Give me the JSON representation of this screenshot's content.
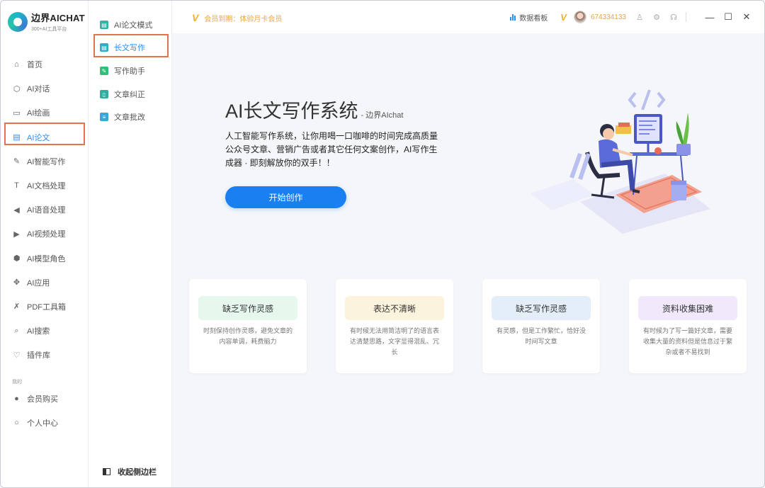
{
  "app": {
    "logo_title": "边界AICHAT",
    "logo_subtitle": "300+AI工具平台"
  },
  "sidebar": {
    "items": [
      {
        "label": "首页",
        "icon": "home-icon"
      },
      {
        "label": "AI对话",
        "icon": "cube-icon"
      },
      {
        "label": "AI绘画",
        "icon": "image-icon"
      },
      {
        "label": "AI论文",
        "icon": "document-icon",
        "active": true
      },
      {
        "label": "AI智能写作",
        "icon": "pen-icon"
      },
      {
        "label": "AI文档处理",
        "icon": "text-icon"
      },
      {
        "label": "AI语音处理",
        "icon": "speaker-icon"
      },
      {
        "label": "AI视频处理",
        "icon": "play-icon"
      },
      {
        "label": "AI模型角色",
        "icon": "cubes-icon"
      },
      {
        "label": "AI应用",
        "icon": "apps-icon"
      },
      {
        "label": "PDF工具箱",
        "icon": "wrench-icon"
      },
      {
        "label": "AI搜索",
        "icon": "search-icon"
      },
      {
        "label": "插件库",
        "icon": "bulb-icon"
      }
    ],
    "section_label": "我的",
    "my_items": [
      {
        "label": "会员购买",
        "icon": "user-icon"
      },
      {
        "label": "个人中心",
        "icon": "user-outline-icon"
      }
    ]
  },
  "subbar": {
    "items": [
      {
        "label": "AI论文模式",
        "color": "#2fb6a8"
      },
      {
        "label": "长文写作",
        "color": "#26b3c4",
        "active": true
      },
      {
        "label": "写作助手",
        "color": "#2fbf7a"
      },
      {
        "label": "文章纠正",
        "color": "#2bb0a0"
      },
      {
        "label": "文章批改",
        "color": "#3aa7d6"
      }
    ],
    "collapse_label": "收起侧边栏"
  },
  "topbar": {
    "vip_text": "会员到期：体验月卡会员",
    "dashboard_label": "数据看板",
    "user_id": "674334133"
  },
  "hero": {
    "title": "AI长文写作系统",
    "brand": "- 边界AIchat",
    "description": "人工智能写作系统，让你用喝一口咖啡的时间完成高质量公众号文章、营销广告或者其它任何文案创作，AI写作生成器 · 即刻解放你的双手！！",
    "cta_label": "开始创作"
  },
  "cards": [
    {
      "tag": "缺乏写作灵感",
      "color": "#e6f7ee",
      "desc": "时刻保持创作灵感，避免文章的内容单调，耗费脑力"
    },
    {
      "tag": "表达不清晰",
      "color": "#fcf3dc",
      "desc": "有时候无法用简洁明了的语言表达清楚思路，文字显得混乱、冗长"
    },
    {
      "tag": "缺乏写作灵感",
      "color": "#e4eef8",
      "desc": "有灵感，但是工作繁忙，恰好没时间写文章"
    },
    {
      "tag": "资料收集困难",
      "color": "#f1e9fb",
      "desc": "有时候为了写一篇好文章，需要收集大量的资料但是信息过于繁杂或者不易找到"
    }
  ],
  "colors": {
    "accent": "#2d8cf0",
    "cta": "#1a7ff0",
    "vip": "#e8a54b",
    "highlight_box": "#e2734d"
  }
}
